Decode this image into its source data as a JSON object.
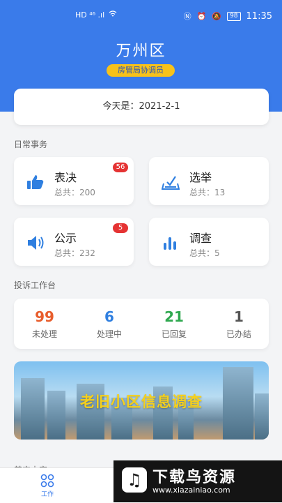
{
  "status": {
    "left": "HD ⁴⁶ .ıl",
    "battery": "98",
    "time": "11:35"
  },
  "header": {
    "title": "万州区",
    "role": "房管局协调员"
  },
  "today": "今天是：2021-2-1",
  "daily": {
    "title": "日常事务",
    "tiles": [
      {
        "name": "表决",
        "count": "总共：200",
        "badge": "56",
        "icon": "thumbs-up-icon"
      },
      {
        "name": "选举",
        "count": "总共：13",
        "badge": "",
        "icon": "ballot-box-icon"
      },
      {
        "name": "公示",
        "count": "总共：232",
        "badge": "5",
        "icon": "speaker-icon"
      },
      {
        "name": "调查",
        "count": "总共：5",
        "badge": "",
        "icon": "bar-chart-icon"
      }
    ]
  },
  "complaints": {
    "title": "投诉工作台",
    "stats": [
      {
        "num": "99",
        "label": "未处理",
        "color": "#e85d2c"
      },
      {
        "num": "6",
        "label": "处理中",
        "color": "#2f7fe0"
      },
      {
        "num": "21",
        "label": "已回复",
        "color": "#2fa84f"
      },
      {
        "num": "1",
        "label": "已办结",
        "color": "#555555"
      }
    ]
  },
  "banner": {
    "text": "老旧小区信息调查"
  },
  "other": {
    "title": "其它内容"
  },
  "tabbar": {
    "label": "工作"
  },
  "watermark": {
    "text": "下载鸟资源",
    "url": "www.xiazainiao.com"
  }
}
